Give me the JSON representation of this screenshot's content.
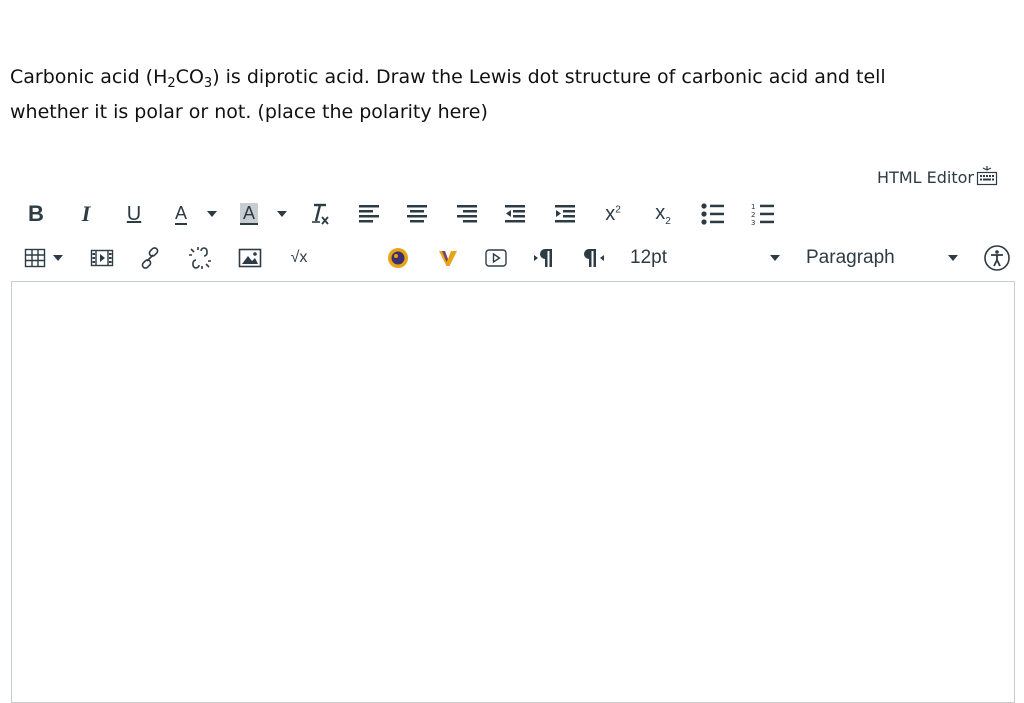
{
  "question": {
    "part1": "Carbonic acid (H",
    "sub1": "2",
    "part2": "CO",
    "sub2": "3",
    "part3": ") is diprotic acid.  Draw the Lewis dot structure of carbonic acid and tell",
    "line2": "whether it is polar or not.  (place the polarity here)"
  },
  "editor": {
    "html_editor_label": "HTML Editor",
    "font_size": "12pt",
    "block_format": "Paragraph",
    "body_text": ""
  },
  "toolbar": {
    "bold": "B",
    "italic": "I",
    "underline": "U",
    "text_color": "A",
    "background_color": "A",
    "superscript_base": "x",
    "subscript_base": "x",
    "sqrt_label": "√x"
  },
  "colors": {
    "link_red": "#8b1a1a",
    "text": "#2d3b45",
    "border": "#c7cdd1",
    "orange": "#e8a317",
    "purple": "#5a2d82"
  }
}
